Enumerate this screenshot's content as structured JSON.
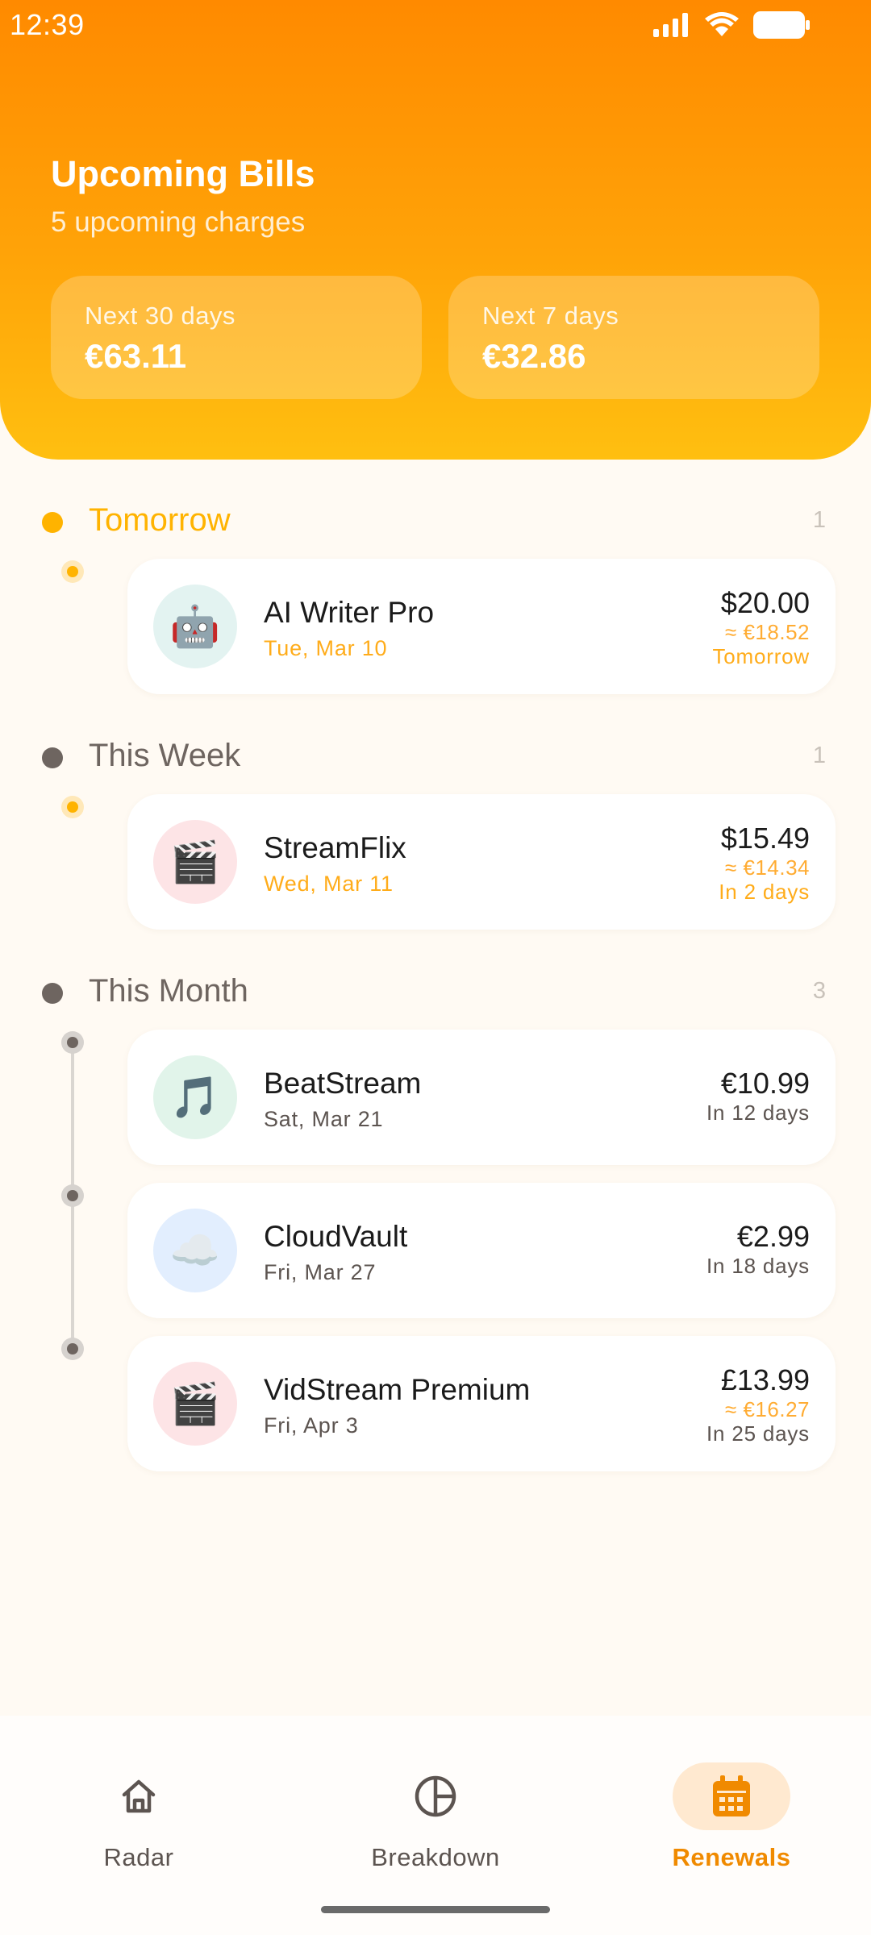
{
  "status_bar": {
    "time": "12:39"
  },
  "header": {
    "title": "Upcoming Bills",
    "subtitle": "5 upcoming charges",
    "cards": [
      {
        "label": "Next 30 days",
        "value": "€63.11"
      },
      {
        "label": "Next 7 days",
        "value": "€32.86"
      }
    ]
  },
  "sections": [
    {
      "title": "Tomorrow",
      "count": "1",
      "accent": "#ffb300",
      "items": [
        {
          "name": "AI Writer Pro",
          "date": "Tue, Mar 10",
          "amount": "$20.00",
          "approx": "≈ €18.52",
          "due": "Tomorrow",
          "icon": "robot-icon",
          "emoji": "🤖",
          "avatar_bg": "#e3f3f1"
        }
      ]
    },
    {
      "title": "This Week",
      "count": "1",
      "items": [
        {
          "name": "StreamFlix",
          "date": "Wed, Mar 11",
          "amount": "$15.49",
          "approx": "≈ €14.34",
          "due": "In 2 days",
          "icon": "clapperboard-icon",
          "emoji": "🎬",
          "avatar_bg": "#fde4e6"
        }
      ]
    },
    {
      "title": "This Month",
      "count": "3",
      "items": [
        {
          "name": "BeatStream",
          "date": "Sat, Mar 21",
          "amount": "€10.99",
          "due": "In 12 days",
          "icon": "music-note-icon",
          "emoji": "🎵",
          "avatar_bg": "#e1f4ea"
        },
        {
          "name": "CloudVault",
          "date": "Fri, Mar 27",
          "amount": "€2.99",
          "due": "In 18 days",
          "icon": "cloud-icon",
          "emoji": "☁️",
          "avatar_bg": "#e2eefe"
        },
        {
          "name": "VidStream Premium",
          "date": "Fri, Apr 3",
          "amount": "£13.99",
          "approx": "≈ €16.27",
          "due": "In 25 days",
          "icon": "clapperboard-icon",
          "emoji": "🎬",
          "avatar_bg": "#fde4e6"
        }
      ]
    }
  ],
  "nav": [
    {
      "label": "Radar",
      "icon": "home-icon"
    },
    {
      "label": "Breakdown",
      "icon": "pie-chart-icon"
    },
    {
      "label": "Renewals",
      "icon": "calendar-icon",
      "active": true
    }
  ],
  "colors": {
    "accent_orange": "#ff8a00",
    "accent_amber": "#ffb300",
    "muted_text": "#5c5450",
    "background": "#fffaf3"
  }
}
